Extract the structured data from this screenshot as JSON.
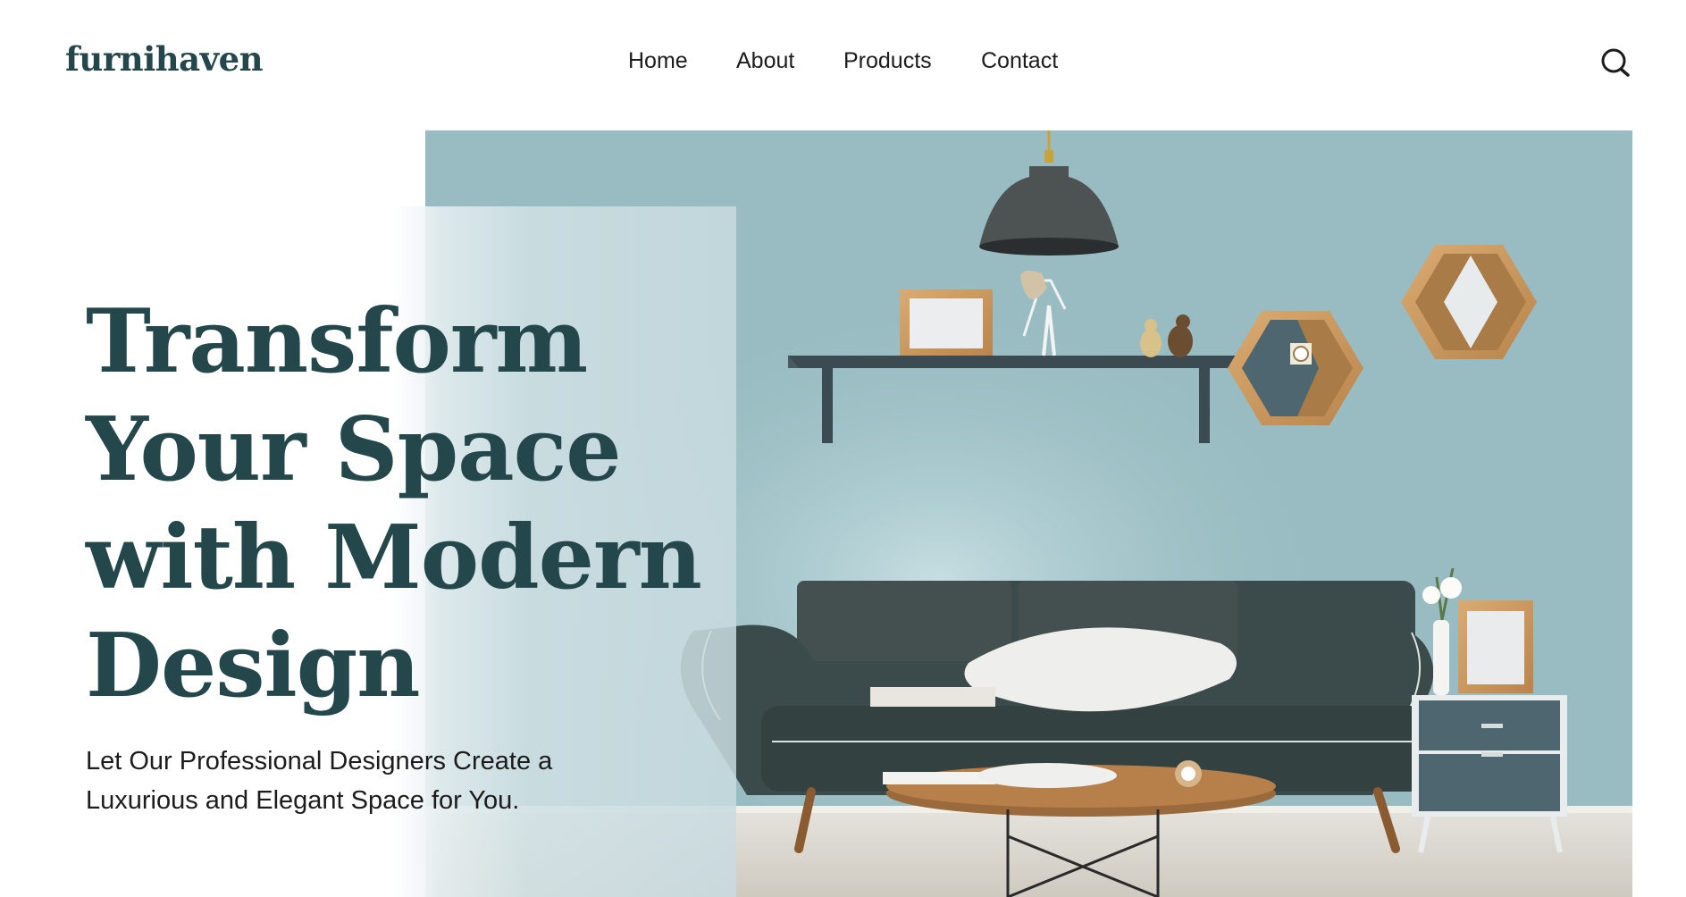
{
  "brand": {
    "logo_text": "furnihaven"
  },
  "nav": {
    "items": [
      {
        "label": "Home"
      },
      {
        "label": "About"
      },
      {
        "label": "Products"
      },
      {
        "label": "Contact"
      }
    ],
    "search_icon": "search-icon"
  },
  "hero": {
    "title_lines": [
      "Transform",
      "Your Space",
      "with Modern",
      "Design"
    ],
    "subtitle_lines": [
      "Let Our Professional Designers Create a",
      "Luxurious and Elegant Space for You."
    ],
    "image_subject": "living-room-scene"
  },
  "colors": {
    "brand_teal": "#23474a",
    "wall": "#98bcc2",
    "sofa": "#3b4a4b"
  }
}
